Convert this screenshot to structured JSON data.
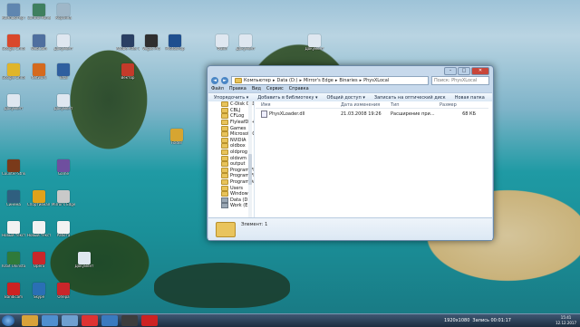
{
  "desktop": {
    "icons": [
      {
        "label": "Компьютер Ярлык",
        "color": "#5f86b0"
      },
      {
        "label": "Control Panel",
        "color": "#3f7f5f"
      },
      {
        "label": "Корзина",
        "color": "#9fb7c8"
      },
      {
        "label": "Google Chrome",
        "color": "#d9482b"
      },
      {
        "label": "WebCam",
        "color": "#4f6f9f"
      },
      {
        "label": "Документ",
        "color": "#dfe7f0"
      },
      {
        "label": "Google Chrome",
        "color": "#e0b52a"
      },
      {
        "label": "Network",
        "color": "#d56a1e"
      },
      {
        "label": "Total",
        "color": "#2f5f9f"
      },
      {
        "label": "Adobe After Effects",
        "color": "#2a3f63"
      },
      {
        "label": "Vegas Pro",
        "color": "#2f2f2f"
      },
      {
        "label": "Photoshop",
        "color": "#1f4f8f"
      },
      {
        "label": "Файл",
        "color": "#dfe7f0"
      },
      {
        "label": "Документ",
        "color": "#dfe7f0"
      },
      {
        "label": "Вектор",
        "color": "#c43a2a"
      },
      {
        "label": "Документ",
        "color": "#dfe7f0"
      },
      {
        "label": "Folder",
        "color": "#d6a531"
      },
      {
        "label": "Документ",
        "color": "#dfe7f0"
      },
      {
        "label": "Документ",
        "color": "#dfe7f0"
      },
      {
        "label": "Counter-Strike",
        "color": "#7a3a1a"
      },
      {
        "label": "Game",
        "color": "#6f4f9f"
      },
      {
        "label": "Синема",
        "color": "#2f5f7f"
      },
      {
        "label": "Спортивная страница",
        "color": "#e0a21a"
      },
      {
        "label": "Mirror's Edge",
        "color": "#c9c9c9"
      },
      {
        "label": "Новый текстовый",
        "color": "#f2f2f2"
      },
      {
        "label": "Новый текстовый",
        "color": "#f2f2f2"
      },
      {
        "label": "Работа",
        "color": "#f2f2f2"
      },
      {
        "label": "IObit Uninstaller",
        "color": "#2f7a3a"
      },
      {
        "label": "Opera",
        "color": "#c9262a"
      },
      {
        "label": "Документ",
        "color": "#dfe7f0"
      },
      {
        "label": "Опера",
        "color": "#c9262a"
      },
      {
        "label": "Skype",
        "color": "#2a6fb5"
      },
      {
        "label": "Bandicam",
        "color": "#c22"
      }
    ]
  },
  "window": {
    "path": [
      "Компьютер",
      "Data (D:)",
      "Mirror's Edge",
      "Binaries",
      "PhysXLocal"
    ],
    "search_placeholder": "Поиск: PhysXLocal",
    "menu": [
      "Файл",
      "Правка",
      "Вид",
      "Сервис",
      "Справка"
    ],
    "toolbar": [
      "Упорядочить ▾",
      "Добавить в библиотеку ▾",
      "Общий доступ ▾",
      "Записать на оптический диск",
      "Новая папка"
    ],
    "nav": [
      {
        "label": "C-Disk OLD",
        "kind": "folder"
      },
      {
        "label": "CBLJ",
        "kind": "folder"
      },
      {
        "label": "CFLog",
        "kind": "folder"
      },
      {
        "label": "FlyleafDC++",
        "kind": "folder"
      },
      {
        "label": "Games",
        "kind": "folder"
      },
      {
        "label": "Microsoft Games",
        "kind": "folder"
      },
      {
        "label": "NVIDIA",
        "kind": "folder"
      },
      {
        "label": "oldbox",
        "kind": "folder"
      },
      {
        "label": "oldprog",
        "kind": "folder"
      },
      {
        "label": "oldsvm",
        "kind": "folder"
      },
      {
        "label": "output",
        "kind": "folder"
      },
      {
        "label": "Program Files",
        "kind": "folder"
      },
      {
        "label": "Program Files (x86)",
        "kind": "folder"
      },
      {
        "label": "ProgramData",
        "kind": "folder"
      },
      {
        "label": "Users",
        "kind": "folder"
      },
      {
        "label": "Windows",
        "kind": "folder"
      },
      {
        "label": "Data (D:)",
        "kind": "drive"
      },
      {
        "label": "Work (E:)",
        "kind": "drive"
      }
    ],
    "columns": [
      "Имя",
      "Дата изменения",
      "Тип",
      "Размер"
    ],
    "files": [
      {
        "name": "PhysXLoader.dll",
        "date": "21.03.2008 19:26",
        "type": "Расширение при...",
        "size": "68 КБ"
      }
    ],
    "status": "Элемент: 1"
  },
  "taskbar": {
    "tray_text": "1920x1080",
    "lang": "Запись 00:01:17",
    "clock_time": "15:41",
    "clock_date": "12.12.2017"
  }
}
